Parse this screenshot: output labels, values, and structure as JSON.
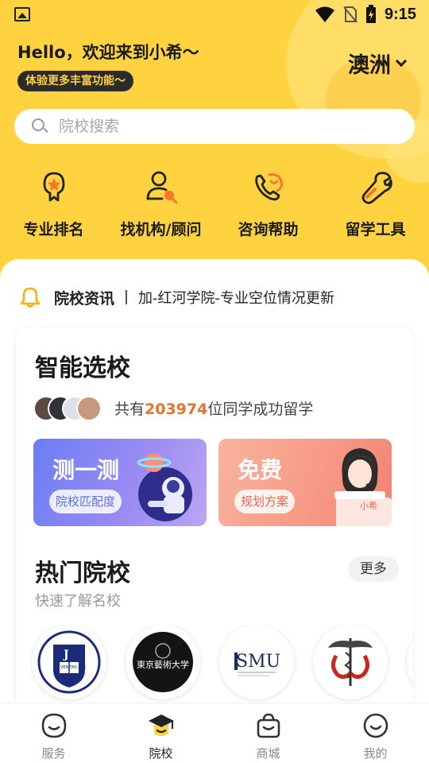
{
  "status_bar": {
    "time": "9:15",
    "icons": [
      "image-icon",
      "wifi-icon",
      "no-sim-icon",
      "battery-charging-icon"
    ]
  },
  "header": {
    "greeting": "Hello，欢迎来到小希～",
    "sub_pill": "体验更多丰富功能～",
    "region": "澳洲",
    "region_icon": "chevron-down-icon"
  },
  "search": {
    "placeholder": "院校搜索",
    "icon": "search-icon"
  },
  "quick_nav": [
    {
      "label": "专业排名",
      "icon": "ribbon-badge-icon"
    },
    {
      "label": "找机构/顾问",
      "icon": "user-search-icon"
    },
    {
      "label": "咨询帮助",
      "icon": "phone-chat-icon"
    },
    {
      "label": "留学工具",
      "icon": "wrench-icon"
    }
  ],
  "news": {
    "icon": "bell-icon",
    "title": "院校资讯",
    "headline": "加-红河学院-专业空位情况更新"
  },
  "smart_select": {
    "title": "智能选校",
    "stat_prefix": "共有",
    "stat_number": "203974",
    "stat_suffix": "位同学成功留学",
    "promos": [
      {
        "title": "测一测",
        "button": "院校匹配度",
        "art": "astronaut-planet-illustration"
      },
      {
        "title": "免费",
        "button": "规划方案",
        "art": "advisor-headset-illustration",
        "art_label": "小希"
      }
    ]
  },
  "hot_schools": {
    "title": "热门院校",
    "subtitle": "快速了解名校",
    "more": "更多",
    "logos": [
      {
        "name": "yale-logo",
        "text": "VERITAS LUX"
      },
      {
        "name": "tokyo-arts-logo",
        "text": "東京藝術大学"
      },
      {
        "name": "smu-logo",
        "text": "SMU"
      },
      {
        "name": "caduceus-logo",
        "text": ""
      },
      {
        "name": "partial-logo",
        "text": ""
      }
    ]
  },
  "bottom_nav": [
    {
      "label": "服务",
      "icon": "smile-bubble-icon",
      "active": false
    },
    {
      "label": "院校",
      "icon": "graduation-cap-icon",
      "active": true
    },
    {
      "label": "商城",
      "icon": "shopping-bag-icon",
      "active": false
    },
    {
      "label": "我的",
      "icon": "profile-smile-icon",
      "active": false
    }
  ],
  "colors": {
    "brand_yellow": "#FFD23F",
    "accent_orange": "#E8732A",
    "promo_blue": "#6C7DF5",
    "promo_pink": "#F79A86"
  }
}
